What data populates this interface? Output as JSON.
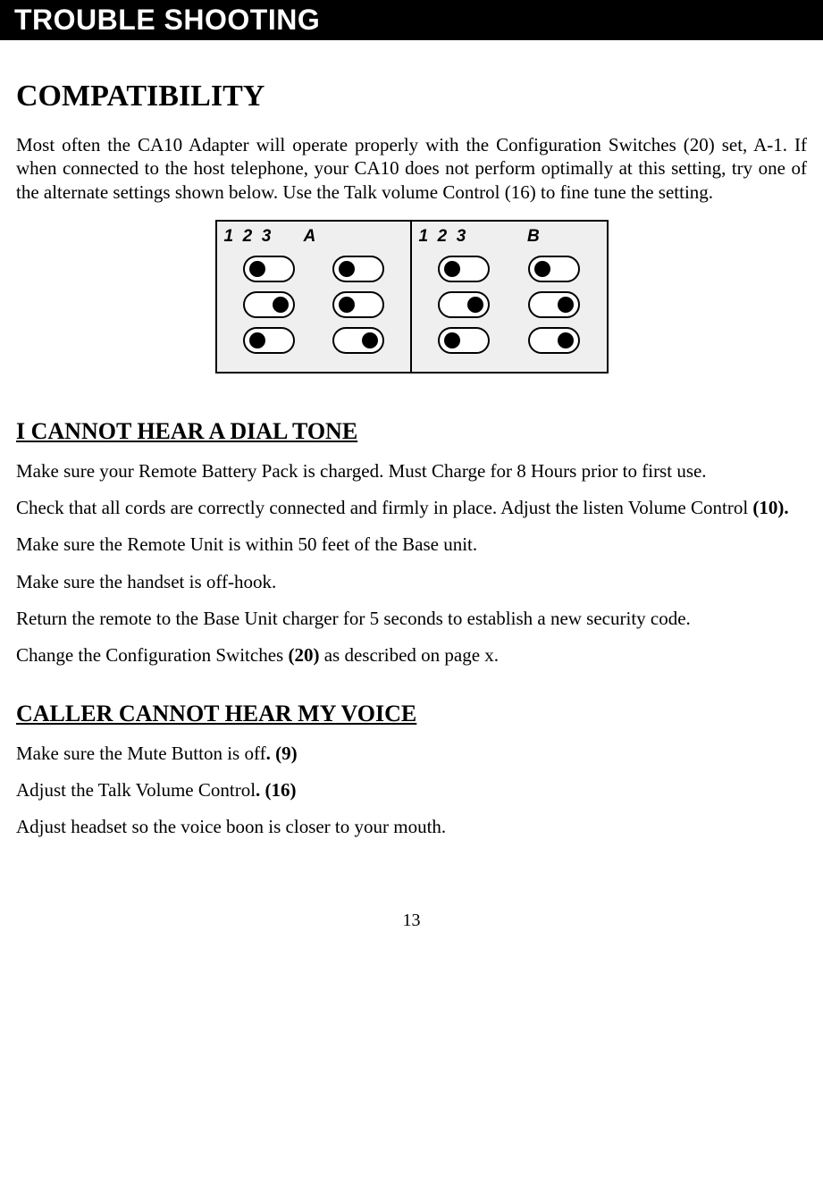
{
  "header": "TROUBLE SHOOTING",
  "section_title": "COMPATIBILITY",
  "intro": "Most often the CA10 Adapter will operate properly with the Configuration Switches (20) set, A-1. If when connected to the host telephone, your CA10 does not perform optimally at this setting, try one of the alternate settings shown below. Use the Talk volume Control (16) to fine tune the setting.",
  "diagram": {
    "panel_a": {
      "labels": "1  2  3       A",
      "rows": [
        [
          "left",
          "left"
        ],
        [
          "right",
          "left"
        ],
        [
          "left",
          "right"
        ]
      ]
    },
    "panel_b": {
      "labels": "1  2  3             B",
      "rows": [
        [
          "left",
          "left"
        ],
        [
          "right",
          "right"
        ],
        [
          "left",
          "right"
        ]
      ]
    }
  },
  "sections": {
    "dial_tone": {
      "heading": "I CANNOT HEAR A DIAL TONE",
      "lines": [
        {
          "text": "Make sure your Remote Battery Pack is charged.  Must Charge for 8 Hours prior to first use."
        },
        {
          "text_pre": "Check that all cords are correctly connected and firmly in place. Adjust the listen Volume Control ",
          "bold": "(10)."
        },
        {
          "text": "Make sure the Remote Unit is within 50 feet of the Base unit."
        },
        {
          "text": "Make sure the handset is off-hook."
        },
        {
          "text": "Return the remote to the Base Unit charger for 5 seconds to establish a new security code."
        },
        {
          "text_pre": "Change the Configuration Switches ",
          "bold": "(20)",
          "text_post": " as described on page x."
        }
      ]
    },
    "voice": {
      "heading": "CALLER CANNOT HEAR MY VOICE",
      "lines": [
        {
          "text_pre": "Make sure the Mute Button is off",
          "bold": ". (9)"
        },
        {
          "text_pre": "Adjust the Talk Volume Control",
          "bold": ". (16)"
        },
        {
          "text": "Adjust headset so the voice boon is closer to your mouth."
        }
      ]
    }
  },
  "page_number": "13"
}
